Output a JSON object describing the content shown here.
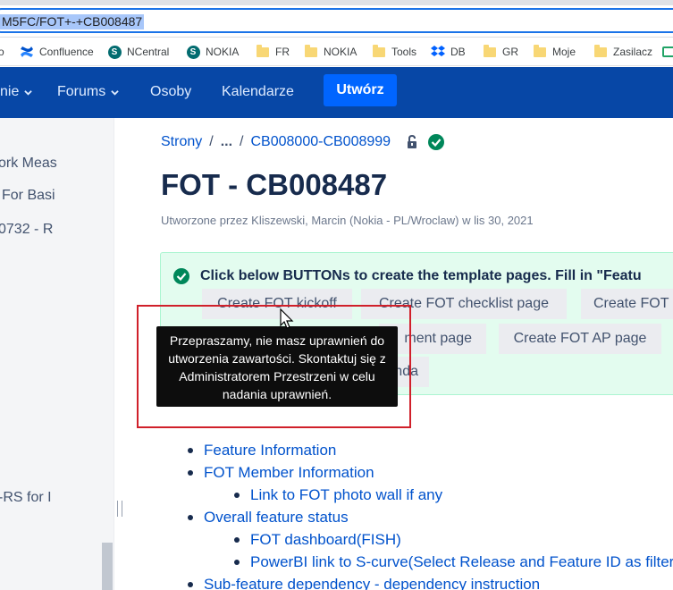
{
  "browser": {
    "url": "M5FC/FOT+-+CB008487",
    "bookmarks": [
      {
        "label": "o",
        "icon": "folder-icon"
      },
      {
        "label": "Confluence",
        "icon": "confluence-icon"
      },
      {
        "label": "NCentral",
        "icon": "sharepoint-icon"
      },
      {
        "label": "NOKIA",
        "icon": "sharepoint-icon"
      },
      {
        "label": "FR",
        "icon": "folder-icon"
      },
      {
        "label": "NOKIA",
        "icon": "folder-icon"
      },
      {
        "label": "Tools",
        "icon": "folder-icon"
      },
      {
        "label": "DB",
        "icon": "dropbox-icon"
      },
      {
        "label": "GR",
        "icon": "folder-icon"
      },
      {
        "label": "Moje",
        "icon": "folder-icon"
      },
      {
        "label": "Zasilacz",
        "icon": "folder-icon"
      }
    ]
  },
  "nav": {
    "items": [
      {
        "label": "nie"
      },
      {
        "label": "Forums"
      },
      {
        "label": "Osoby"
      },
      {
        "label": "Kalendarze"
      }
    ],
    "create_label": "Utwórz"
  },
  "sidebar": {
    "items": [
      "ork Meas",
      "For Basi",
      "0732 - R",
      "-RS for I"
    ]
  },
  "breadcrumb": {
    "root": "Strony",
    "separator": "/",
    "ellipsis": "...",
    "current": "CB008000-CB008999"
  },
  "page": {
    "title": "FOT - CB008487",
    "byline": "Utworzone przez Kliszewski, Marcin (Nokia - PL/Wroclaw) w lis 30, 2021"
  },
  "panel": {
    "heading": "Click below BUTTONs to create the template pages. Fill in \"Featu",
    "buttons": [
      "Create FOT kickoff",
      "Create FOT checklist page",
      "Create FOT",
      "ment page",
      "Create FOT AP page",
      "nda"
    ]
  },
  "tooltip": {
    "text": "Przepraszamy, nie masz uprawnień do utworzenia zawartości. Skontaktuj się z Administratorem Przestrzeni w celu nadania uprawnień."
  },
  "bullets": [
    {
      "label": "Feature Information",
      "level": 1
    },
    {
      "label": "FOT Member Information",
      "level": 1
    },
    {
      "label": "Link to FOT photo wall if any",
      "level": 2
    },
    {
      "label": "Overall feature status",
      "level": 1
    },
    {
      "label": "FOT dashboard(FISH)",
      "level": 2
    },
    {
      "label": "PowerBI link to S-curve(Select Release and Feature ID as filter)",
      "level": 2
    },
    {
      "label": "Sub-feature dependency - dependency instruction",
      "level": 1
    }
  ],
  "colors": {
    "nav_bg": "#0747a6",
    "create_btn": "#0065ff",
    "panel_bg": "#e3fcef",
    "success_green": "#00875a",
    "link": "#0052cc",
    "highlight_box": "#d0202a"
  }
}
